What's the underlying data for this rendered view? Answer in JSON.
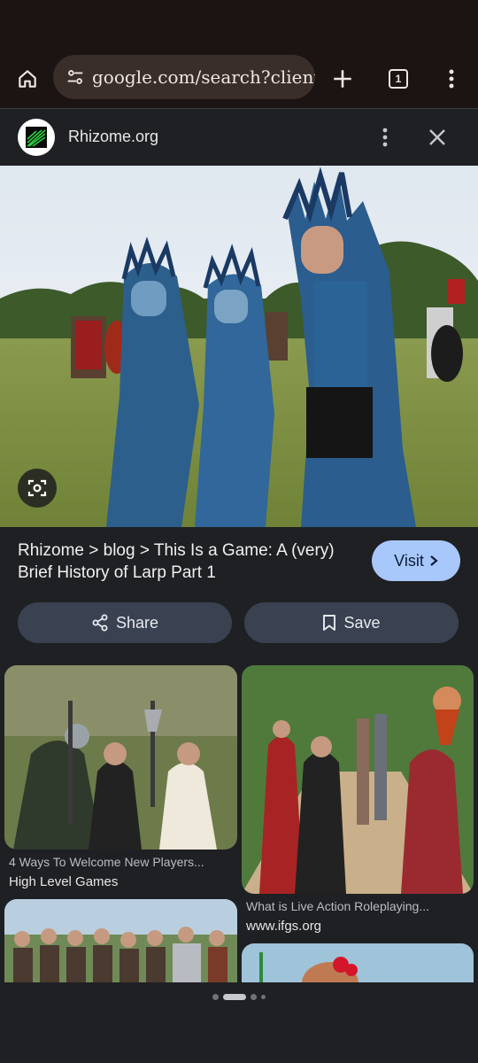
{
  "browser": {
    "url": "google.com/search?client",
    "tab_count": "1"
  },
  "site": {
    "name": "Rhizome.org"
  },
  "result": {
    "caption": "Rhizome > blog > This Is a Game: A (very) Brief History of Larp Part 1",
    "visit_label": "Visit",
    "share_label": "Share",
    "save_label": "Save"
  },
  "related": [
    {
      "title": "4 Ways To Welcome New Players...",
      "source": "High Level Games"
    },
    {
      "title": "What is Live Action Roleplaying...",
      "source": "www.ifgs.org"
    }
  ],
  "icons": {
    "home": "home-icon",
    "tune": "tune-icon",
    "new_tab": "plus-icon",
    "tabs": "tab-switcher-icon",
    "menu": "more-vert-icon",
    "close": "close-icon",
    "lens": "lens-icon",
    "share": "share-icon",
    "save": "bookmark-icon",
    "visit": "chevron-right-icon"
  },
  "colors": {
    "accent": "#a8c7fa",
    "panel": "#1f2024",
    "toolbar": "#1b1412"
  }
}
